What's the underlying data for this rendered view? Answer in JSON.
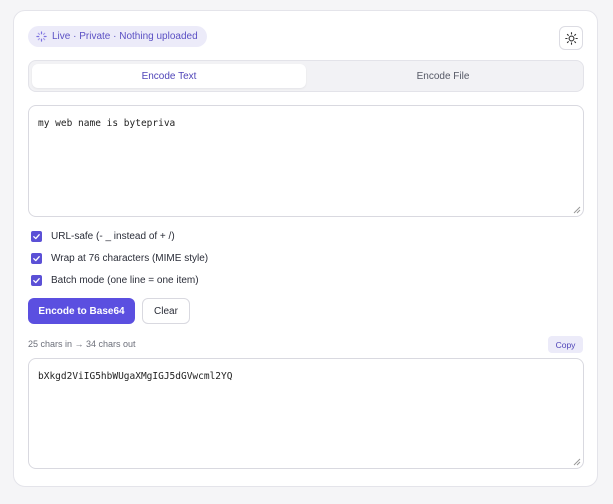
{
  "status_badge": {
    "text": "Live · Private · Nothing uploaded",
    "icon": "spinner-icon"
  },
  "theme_toggle": {
    "icon": "sun-icon"
  },
  "tabs": [
    {
      "label": "Encode Text",
      "active": true
    },
    {
      "label": "Encode File",
      "active": false
    }
  ],
  "input": {
    "value": "my web name is  bytepriva"
  },
  "options": [
    {
      "label": "URL-safe (- _ instead of + /)",
      "checked": true
    },
    {
      "label": "Wrap at 76 characters (MIME style)",
      "checked": true
    },
    {
      "label": "Batch mode (one line = one item)",
      "checked": true
    }
  ],
  "actions": {
    "encode_label": "Encode to Base64",
    "clear_label": "Clear"
  },
  "stats": {
    "text": "25 chars in → 34 chars out"
  },
  "copy_label": "Copy",
  "output": {
    "value": "bXkgd2ViIG5hbWUgaXMgIGJ5dGVwcml2YQ"
  },
  "colors": {
    "accent": "#5b4fe0",
    "badge_bg": "#ecebf9",
    "badge_text": "#5b50c4",
    "page_bg": "#f5f5f7"
  }
}
